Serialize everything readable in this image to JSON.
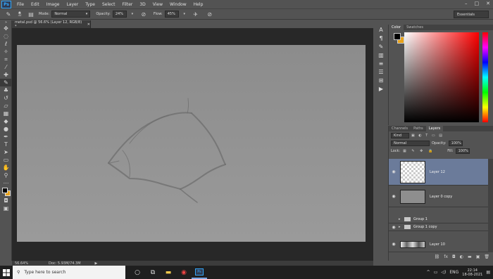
{
  "app": {
    "logo": "Ps"
  },
  "menu": [
    "File",
    "Edit",
    "Image",
    "Layer",
    "Type",
    "Select",
    "Filter",
    "3D",
    "View",
    "Window",
    "Help"
  ],
  "window_controls": {
    "minimize": "–",
    "maximize": "□",
    "close": "✕"
  },
  "options": {
    "brush_size": "32",
    "mode_label": "Mode:",
    "mode_value": "Normal",
    "opacity_label": "Opacity:",
    "opacity_value": "24%",
    "flow_label": "Flow:",
    "flow_value": "45%"
  },
  "workspace": {
    "value": "Essentials"
  },
  "document": {
    "tab_title": "metal.psd @ 56.6% (Layer 12, RGB/8) *",
    "zoom": "56.64%",
    "doc_info": "Doc: 5.93M/74.3M"
  },
  "color_panel": {
    "tabs": [
      "Color",
      "Swatches"
    ],
    "active_tab": "Color"
  },
  "layers_panel": {
    "tabs": [
      "Channels",
      "Paths",
      "Layers"
    ],
    "active_tab": "Layers",
    "filter_kind": "Kind",
    "blend_mode": "Normal",
    "opacity_label": "Opacity:",
    "opacity_value": "100%",
    "lock_label": "Lock:",
    "fill_label": "Fill:",
    "fill_value": "100%",
    "layers": [
      {
        "name": "Layer 12",
        "type": "layer",
        "selected": true,
        "visible": true
      },
      {
        "name": "Layer 0 copy",
        "type": "layer",
        "selected": false,
        "visible": true
      },
      {
        "name": "Group 1",
        "type": "group",
        "selected": false,
        "visible": false
      },
      {
        "name": "Group 1 copy",
        "type": "group",
        "selected": false,
        "visible": true
      },
      {
        "name": "Layer 10",
        "type": "layer",
        "selected": false,
        "visible": true
      }
    ]
  },
  "taskbar": {
    "search_placeholder": "Type here to search",
    "language": "ENG",
    "time": "22:14",
    "date": "18-08-2021"
  },
  "colors": {
    "foreground": "#000000",
    "background": "#e8a21a",
    "selected_layer": "#6b7b9a"
  }
}
